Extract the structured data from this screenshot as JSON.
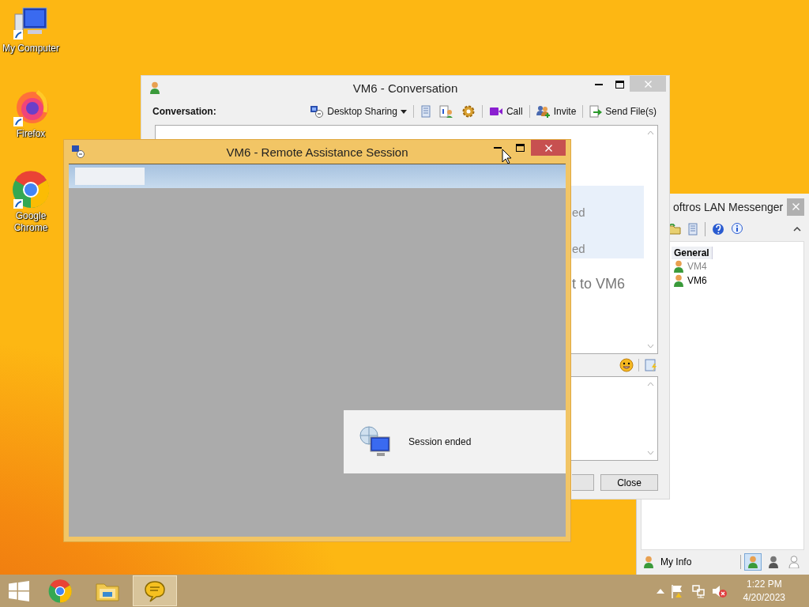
{
  "desktop_icons": [
    {
      "kind": "computer",
      "label": "My Computer"
    },
    {
      "kind": "firefox",
      "label": "Firefox"
    },
    {
      "kind": "chrome",
      "label": "Google Chrome"
    }
  ],
  "messenger_window": {
    "title": "oftros LAN Messenger",
    "group": "General",
    "contacts": [
      {
        "name": "VM4",
        "online": false
      },
      {
        "name": "VM6",
        "online": true
      }
    ],
    "my_info": "My Info",
    "statuses": [
      {
        "kind": "available",
        "selected": true
      },
      {
        "kind": "busy",
        "selected": false
      },
      {
        "kind": "offline",
        "selected": false
      }
    ]
  },
  "conversation_window": {
    "title": "VM6 - Conversation",
    "label": "Conversation:",
    "toolbar": [
      {
        "kind": "desktop-sharing",
        "label": "Desktop Sharing"
      },
      {
        "kind": "history"
      },
      {
        "kind": "info"
      },
      {
        "kind": "settings"
      },
      {
        "kind": "call",
        "label": "Call"
      },
      {
        "kind": "invite",
        "label": "Invite"
      },
      {
        "kind": "send-file",
        "label": "Send File(s)"
      }
    ],
    "history": [
      "ed",
      "ed",
      "t to VM6"
    ],
    "close_button": "Close"
  },
  "remote_window": {
    "title": "VM6 - Remote Assistance Session",
    "notice": "Session ended"
  },
  "taskbar": {
    "apps": [
      {
        "kind": "chrome",
        "active": false
      },
      {
        "kind": "explorer",
        "active": false
      },
      {
        "kind": "messenger",
        "active": true
      }
    ],
    "time": "1:22 PM",
    "date": "4/20/2023"
  }
}
